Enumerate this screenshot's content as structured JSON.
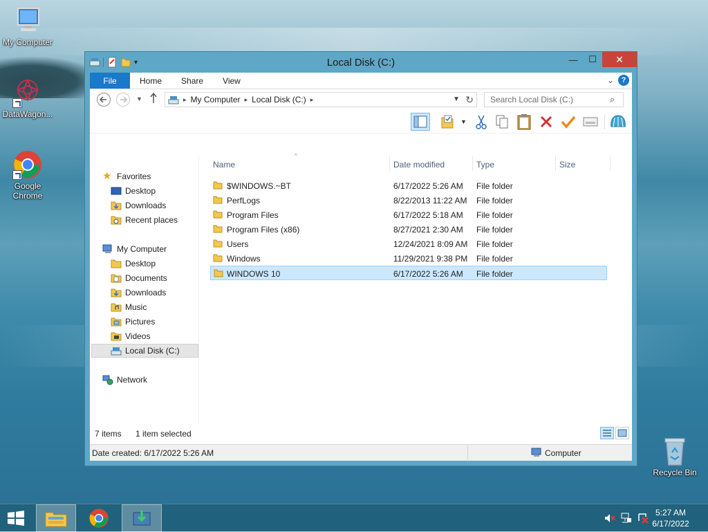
{
  "desktop": {
    "icons": [
      {
        "label": "My Computer"
      },
      {
        "label": "DataWagon..."
      },
      {
        "label": "Google Chrome"
      },
      {
        "label": "Recycle Bin"
      }
    ]
  },
  "window": {
    "title": "Local Disk (C:)",
    "controls": {
      "minimize": "—",
      "maximize": "☐",
      "close": "✕"
    },
    "ribbon_tabs": [
      "File",
      "Home",
      "Share",
      "View"
    ],
    "help": "?",
    "expand_ribbon": "⌄",
    "address": {
      "segments": [
        "My Computer",
        "Local Disk (C:)"
      ]
    },
    "search": {
      "placeholder": "Search Local Disk (C:)"
    },
    "nav": {
      "favorites": {
        "label": "Favorites",
        "items": [
          "Desktop",
          "Downloads",
          "Recent places"
        ]
      },
      "computer": {
        "label": "My Computer",
        "items": [
          "Desktop",
          "Documents",
          "Downloads",
          "Music",
          "Pictures",
          "Videos",
          "Local Disk (C:)"
        ]
      },
      "network": {
        "label": "Network"
      }
    },
    "columns": {
      "name": "Name",
      "date": "Date modified",
      "type": "Type",
      "size": "Size"
    },
    "files": [
      {
        "name": "$WINDOWS.~BT",
        "date": "6/17/2022 5:26 AM",
        "type": "File folder"
      },
      {
        "name": "PerfLogs",
        "date": "8/22/2013 11:22 AM",
        "type": "File folder"
      },
      {
        "name": "Program Files",
        "date": "6/17/2022 5:18 AM",
        "type": "File folder"
      },
      {
        "name": "Program Files (x86)",
        "date": "8/27/2021 2:30 AM",
        "type": "File folder"
      },
      {
        "name": "Users",
        "date": "12/24/2021 8:09 AM",
        "type": "File folder"
      },
      {
        "name": "Windows",
        "date": "11/29/2021 9:38 PM",
        "type": "File folder"
      },
      {
        "name": "WINDOWS 10",
        "date": "6/17/2022 5:26 AM",
        "type": "File folder"
      }
    ],
    "status": {
      "count": "7 items",
      "selected": "1 item selected"
    },
    "info": {
      "date_created": "Date created: 6/17/2022 5:26 AM",
      "location": "Computer"
    }
  },
  "taskbar": {
    "clock": {
      "time": "5:27 AM",
      "date": "6/17/2022"
    }
  },
  "colors": {
    "accent": "#1979ca",
    "selection": "#cce8ff",
    "close": "#c8443a"
  }
}
